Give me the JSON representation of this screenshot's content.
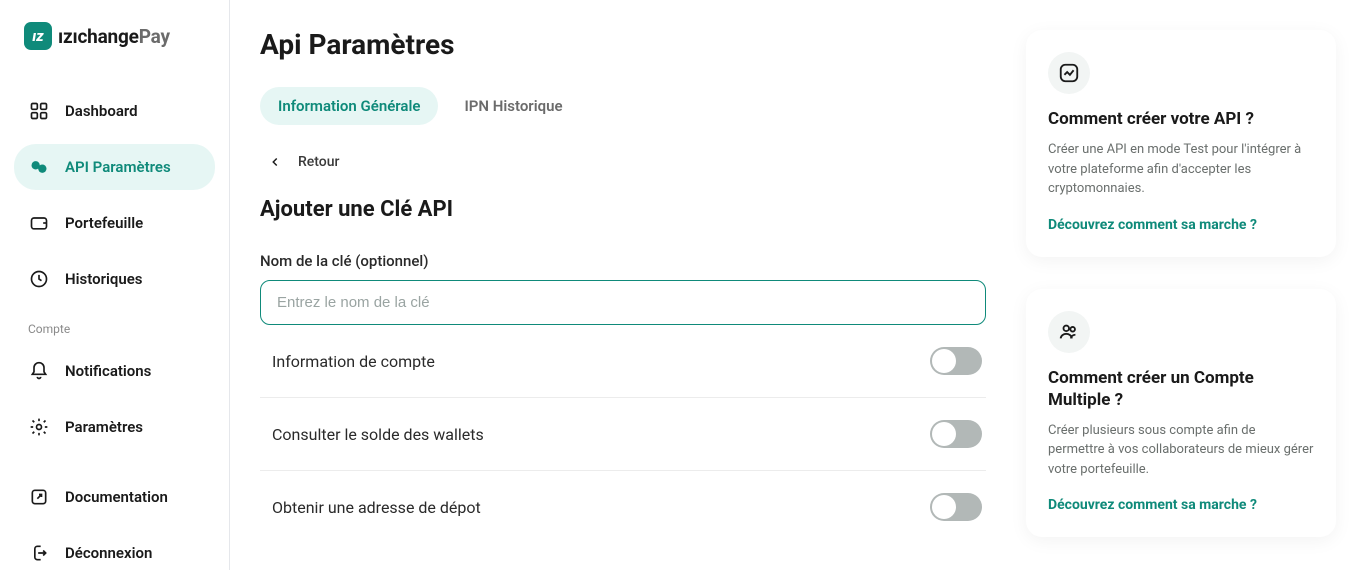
{
  "brand": {
    "name": "ızıchange",
    "suffix": "Pay",
    "mark": "ız"
  },
  "sidebar": {
    "items": [
      {
        "label": "Dashboard"
      },
      {
        "label": "API Paramètres"
      },
      {
        "label": "Portefeuille"
      },
      {
        "label": "Historiques"
      }
    ],
    "section_label": "Compte",
    "account_items": [
      {
        "label": "Notifications"
      },
      {
        "label": "Paramètres"
      },
      {
        "label": "Documentation"
      },
      {
        "label": "Déconnexion"
      }
    ]
  },
  "page": {
    "title": "Api Paramètres",
    "tabs": [
      {
        "label": "Information Générale"
      },
      {
        "label": "IPN Historique"
      }
    ],
    "back_label": "Retour",
    "section_title": "Ajouter une Clé API",
    "key_name_label": "Nom de la clé (optionnel)",
    "key_name_placeholder": "Entrez le nom de la clé",
    "permissions": [
      {
        "label": "Information de compte"
      },
      {
        "label": "Consulter le solde des wallets"
      },
      {
        "label": "Obtenir une adresse de dépot"
      }
    ]
  },
  "cards": [
    {
      "title": "Comment créer votre API ?",
      "body": "Créer une API en mode Test pour l'intégrer à votre plateforme afin d'accepter les cryptomonnaies.",
      "link": "Découvrez comment sa marche ?"
    },
    {
      "title": "Comment créer un Compte Multiple ?",
      "body": "Créer plusieurs sous compte afin de permettre à vos collaborateurs de mieux gérer votre portefeuille.",
      "link": "Découvrez comment sa marche ?"
    }
  ],
  "colors": {
    "accent": "#0f8a7a"
  }
}
